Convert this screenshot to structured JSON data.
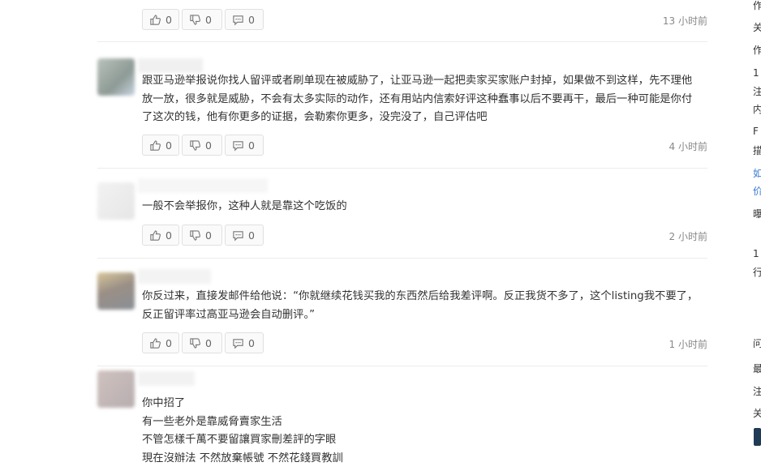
{
  "comments": [
    {
      "text": "",
      "likes": "0",
      "dislikes": "0",
      "replies": "0",
      "time": "13 小时前"
    },
    {
      "text": "跟亚马逊举报说你找人留评或者刷单现在被威胁了，让亚马逊一起把卖家买家账户封掉，如果做不到这样，先不理他放一放，很多就是威胁，不会有太多实际的动作，还有用站内信索好评这种蠢事以后不要再干，最后一种可能是你付了这次的钱，他有你更多的证据，会勒索你更多，没完没了，自己评估吧",
      "likes": "0",
      "dislikes": "0",
      "replies": "0",
      "time": "4 小时前"
    },
    {
      "text": "一般不会举报你，这种人就是靠这个吃饭的",
      "likes": "0",
      "dislikes": "0",
      "replies": "0",
      "time": "2 小时前"
    },
    {
      "text": "你反过来，直接发邮件给他说：“你就继续花钱买我的东西然后给我差评啊。反正我货不多了，这个listing我不要了，反正留评率过高亚马逊会自动删评。”",
      "likes": "0",
      "dislikes": "0",
      "replies": "0",
      "time": "1 小时前"
    },
    {
      "text": "你中招了\n有一些老外是靠威脅賣家生活\n不管怎樣千萬不要留讓買家刪差評的字眼\n現在沒辦法 不然放棄帳號 不然花錢買教訓"
    }
  ],
  "sidebar": {
    "fragments": [
      "作",
      "关",
      "作",
      "1",
      "注",
      "内",
      "F",
      "描",
      "如",
      "价",
      "曝",
      "1",
      "行",
      "问",
      "最",
      "注",
      "关"
    ]
  },
  "colors": {
    "link_blue": "#3b7bd4",
    "divider": "#ececec"
  },
  "icons": [
    "thumbs-up-icon",
    "thumbs-down-icon",
    "comment-icon"
  ]
}
